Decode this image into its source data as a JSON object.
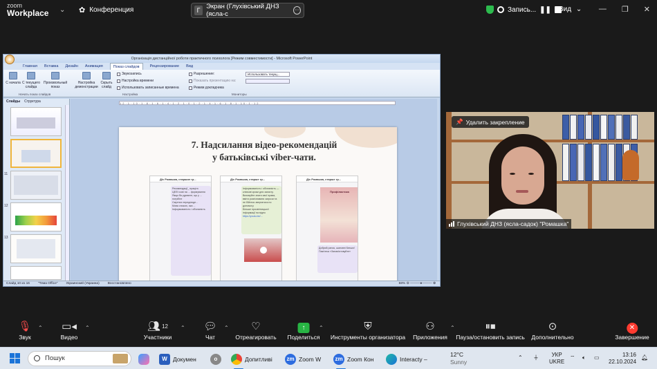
{
  "topbar": {
    "logo_line1": "zoom",
    "logo_line2": "Workplace",
    "conference": "Конференция",
    "share_initial": "Г",
    "share_title": "Экран (Глухівський ДНЗ (ясла-с",
    "recording": "Запись...",
    "view": "Вид"
  },
  "ppt": {
    "window_title": "Організація дистанційної роботи практичного психолога [Режим совместимости] - Microsoft PowerPoint",
    "tabs": [
      "Главная",
      "Вставка",
      "Дизайн",
      "Анимация",
      "Показ слайдов",
      "Рецензирование",
      "Вид"
    ],
    "ribbon": {
      "btn_from_start": "С начала",
      "btn_from_current": "С текущего слайда",
      "btn_custom": "Произвольный показ",
      "btn_setup": "Настройка демонстрации",
      "btn_hide": "Скрыть слайд",
      "rehearse": "Звукозапись",
      "timings": "Настройка времени",
      "use_timings": "Использовать записанные времена",
      "resolution": "Разрешение:",
      "resolution_value": "Использовать текущ...",
      "show_presentation_on": "Показать презентацию на:",
      "presenter_view": "Режим докладчика",
      "group_start": "Начать показ слайдов",
      "group_setup": "Настройка",
      "group_monitors": "Мониторы"
    },
    "left_tabs": [
      "Слайды",
      "Структура"
    ],
    "thumb_numbers": [
      "",
      "",
      "11",
      "12",
      "13",
      ""
    ],
    "ruler": "12·1·10·1·8·1·6·1·4·1·2·1·0·1·2·1·4·1·6·1·8·1·10·1·12",
    "slide": {
      "title_line1": "7. Надсилання відео-рекомендацій",
      "title_line2": "у батьківські viber-чати.",
      "phones": [
        {
          "header": "Д/с Ромашка, старшие гр...",
          "lines": [
            "Рекомендації_ праціта",
            "ЦЕЛІ ісові на ... формування",
            "Якщо Ви думаєте, що у ... потрібне",
            "Смутних передлюде... ",
            "Мова спокою, яка ...",
            "Інформованість і обізнаність"
          ]
        },
        {
          "header": "Д/с Ромашка, старше гр...",
          "lines": [
            "Інформованість і обізнаність — ключові кроки для захисту. Виховуйте знати свої права, вміти розпізнавати загрози та не бійтеся звертатися по допомогу.",
            "Більше просвітницької інформації на відео",
            "https://youtu.be/..."
          ]
        },
        {
          "header": "Д/с Ромашка, старше гр...",
          "lines": [
            "Профілактика",
            "Добрий ранок, шановні батьки!",
            "Пам'ятка «Запам'ятовуйте»"
          ]
        }
      ]
    },
    "status": {
      "slide_of": "Слайд 10 из 16",
      "theme": "\"Тема Office\"",
      "language": "Украинский (Украина)",
      "recover": "Восстановлено",
      "zoom": "68%"
    }
  },
  "video": {
    "unpin": "Удалить закрепление",
    "name": "Глухівський ДНЗ (ясла-садок) \"Ромашка\""
  },
  "toolbar": {
    "audio": "Звук",
    "video": "Видео",
    "participants": "Участники",
    "participants_count": "12",
    "chat": "Чат",
    "react": "Отреагировать",
    "share": "Поделиться",
    "host_tools": "Инструменты организатора",
    "apps": "Приложения",
    "pause_record": "Пауза/остановить запись",
    "more": "Дополнительно",
    "end": "Завершение"
  },
  "taskbar": {
    "search": "Пошук",
    "apps": [
      "Докумен",
      "Допитливі",
      "Zoom W",
      "Zoom Кон",
      "Interacty –"
    ],
    "weather_temp": "12°C",
    "weather_desc": "Sunny",
    "lang_1": "УКР",
    "lang_2": "UKRE",
    "time": "13:16",
    "date": "22.10.2024"
  }
}
